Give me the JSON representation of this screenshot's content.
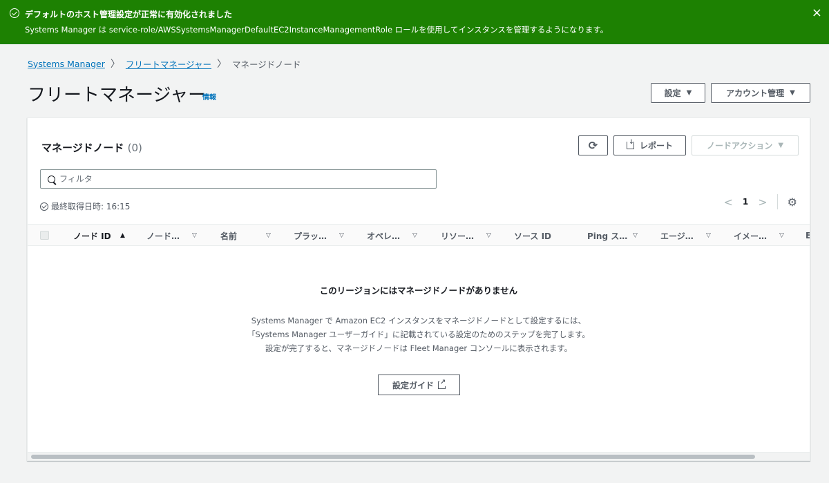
{
  "flash": {
    "title": "デフォルトのホスト管理設定が正常に有効化されました",
    "message": "Systems Manager は service-role/AWSSystemsManagerDefaultEC2InstanceManagementRole ロールを使用してインスタンスを管理するようになります。",
    "status": "success",
    "color": "#1d8102",
    "close_icon": "×"
  },
  "breadcrumb": {
    "items": [
      "Systems Manager",
      "フリートマネージャー",
      "マネージドノード"
    ],
    "separator": "〉"
  },
  "header": {
    "title": "フリートマネージャー",
    "info_link": "情報",
    "settings_label": "設定",
    "account_label": "アカウント管理"
  },
  "panel": {
    "title": "マネージドノード",
    "count": "(0)",
    "refresh_icon": "⟳",
    "report_label": "レポート",
    "node_action_label": "ノードアクション",
    "filter_placeholder": "フィルタ",
    "last_updated": "最終取得日時: 16:15",
    "page": "1",
    "columns": [
      "ノード ID",
      "ノード…",
      "名前",
      "プラッ…",
      "オペレ…",
      "リソー…",
      "ソース ID",
      "Ping ス…",
      "エージ…",
      "イメー…",
      "E"
    ],
    "sorted_column": "ノード ID",
    "sort_direction": "ascending"
  },
  "empty_state": {
    "heading": "このリージョンにはマネージドノードがありません",
    "line1": "Systems Manager で Amazon EC2 インスタンスをマネージドノードとして設定するには、",
    "line2": "「Systems Manager ユーザーガイド」に記載されている設定のためのステップを完了します。",
    "line3": "設定が完了すると、マネージドノードは Fleet Manager コンソールに表示されます。",
    "guide_button": "設定ガイド"
  },
  "colors": {
    "link": "#0073bb",
    "success": "#1d8102",
    "text": "#16191f",
    "muted": "#545b64"
  }
}
